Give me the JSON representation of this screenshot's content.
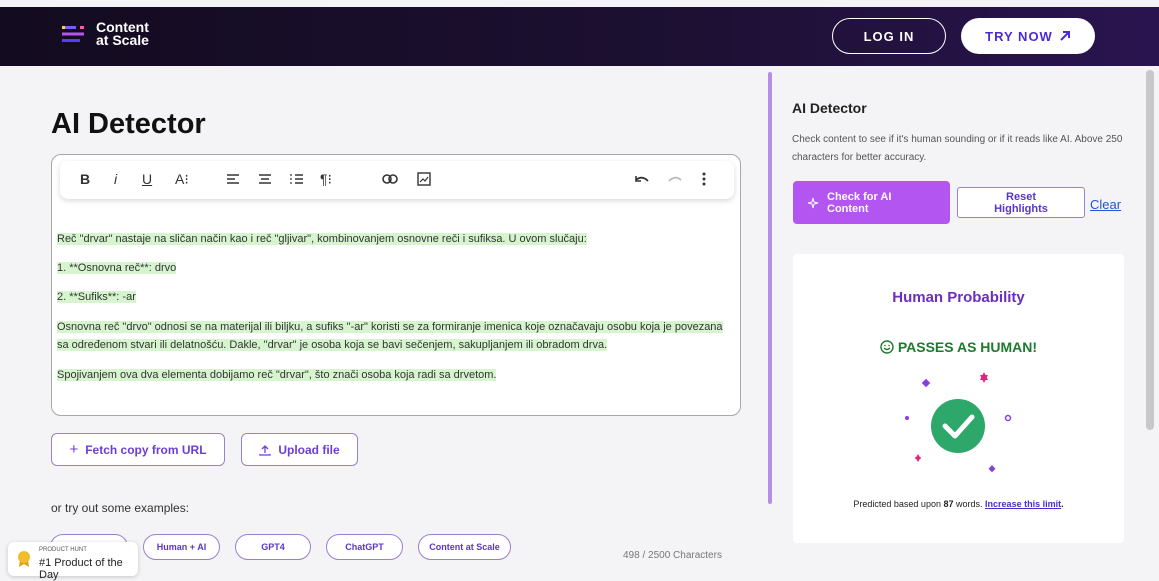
{
  "header": {
    "logo_line1": "Content",
    "logo_line2": "at Scale",
    "login_label": "LOG IN",
    "try_label": "TRY NOW"
  },
  "main": {
    "title": "AI Detector",
    "toolbar": {
      "bold": "B",
      "italic": "i",
      "underline": "U",
      "text_size": "A⁝",
      "paragraph": "¶⁝"
    },
    "paragraphs": [
      "Reč \"drvar\" nastaje na sličan način kao i reč \"gljivar\", kombinovanjem osnovne reči i sufiksa. U ovom slučaju:",
      "1. **Osnovna reč**: drvo",
      "2. **Sufiks**: -ar",
      "Osnovna reč \"drvo\" odnosi se na materijal ili biljku, a sufiks \"-ar\" koristi se za formiranje imenica koje označavaju osobu koja je povezana sa određenom stvari ili delatnošću. Dakle, \"drvar\" je osoba koja se bavi sečenjem, sakupljanjem ili obradom drva.",
      "Spojivanjem ova dva elementa dobijamo reč \"drvar\", što znači osoba koja radi sa drvetom."
    ],
    "fetch_label": "Fetch copy from URL",
    "upload_label": "Upload file",
    "examples_label": "or try out some examples:",
    "examples": [
      "Human + AI",
      "GPT4",
      "ChatGPT",
      "Content at Scale"
    ],
    "char_count": "498 / 2500 Characters"
  },
  "badge": {
    "small": "PRODUCT HUNT",
    "big": "#1 Product of the Day"
  },
  "sidebar": {
    "title": "AI Detector",
    "description": "Check content to see if it's human sounding or if it reads like AI. Above 250 characters for better accuracy.",
    "check_label": "Check for AI Content",
    "reset_label": "Reset Highlights",
    "clear_label": "Clear",
    "result": {
      "heading": "Human Probability",
      "verdict": "PASSES AS HUMAN!",
      "predicted_prefix": "Predicted based upon",
      "word_count": "87",
      "predicted_mid": "words.",
      "increase_link": "Increase this limit",
      "period": "."
    }
  },
  "colors": {
    "accent": "#b355f0",
    "brand_dark": "#1d1033",
    "pass_green": "#1d7a2e",
    "highlight": "#d6f5cf"
  }
}
